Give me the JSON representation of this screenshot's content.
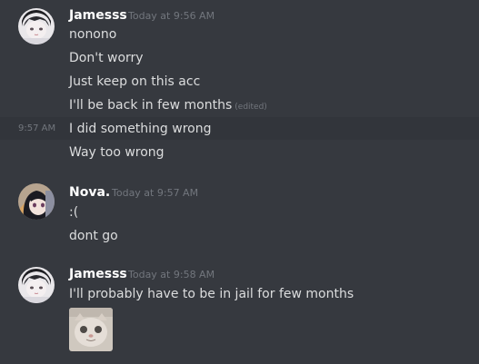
{
  "groups": [
    {
      "author": "Jamesss",
      "timestamp": "Today at 9:56 AM",
      "messages": [
        {
          "text": "nonono"
        },
        {
          "text": "Don't worry"
        },
        {
          "text": "Just keep on this acc"
        },
        {
          "text": "I'll be back in few months",
          "edited": "(edited)"
        },
        {
          "text": "I did something wrong",
          "hover_time": "9:57 AM"
        },
        {
          "text": "Way too wrong"
        }
      ]
    },
    {
      "author": "Nova.",
      "timestamp": "Today at 9:57 AM",
      "messages": [
        {
          "text": ":("
        },
        {
          "text": "dont go"
        }
      ]
    },
    {
      "author": "Jamesss",
      "timestamp": "Today at 9:58 AM",
      "messages": [
        {
          "text": "I'll probably have to be in jail for few months"
        }
      ],
      "attachment": {
        "icon": "cat-image-thumbnail"
      }
    }
  ],
  "colors": {
    "background": "#36393f",
    "hover": "#32353b",
    "username": "#ffffff",
    "text": "#dcddde",
    "muted": "#72767d"
  }
}
